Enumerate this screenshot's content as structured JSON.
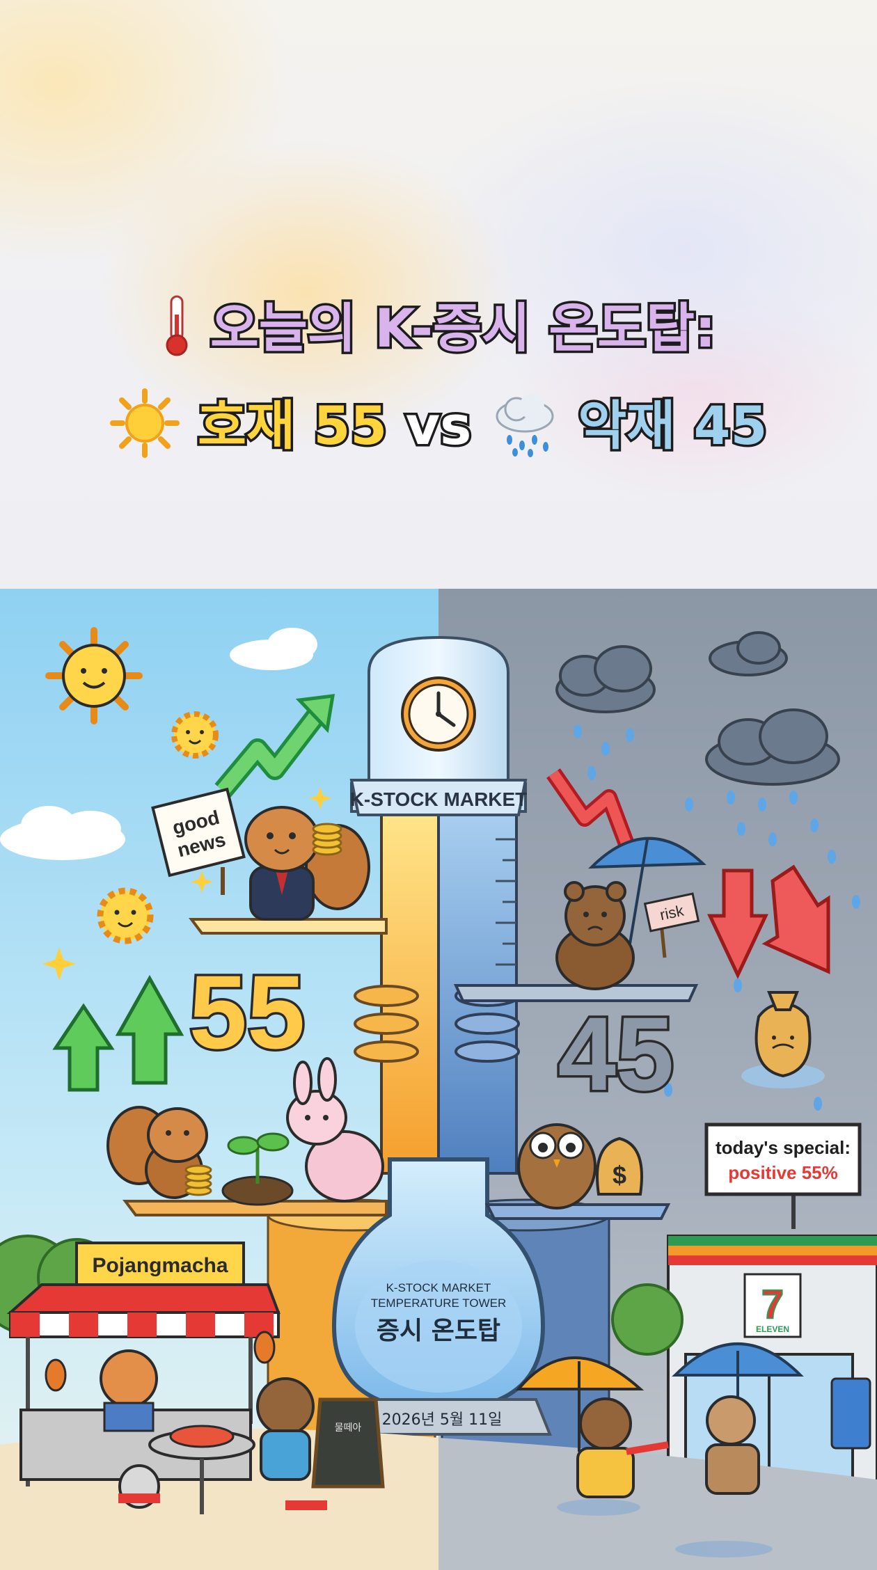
{
  "header": {
    "title_line1": "오늘의 K-증시 온도탑:",
    "good_label": "호재 55",
    "vs": "vs",
    "bad_label": "악재 45",
    "icons": [
      "thermometer-icon",
      "sun-icon",
      "rain-cloud-icon"
    ]
  },
  "scene": {
    "tower_banner": "K-STOCK MARKET",
    "good_value": "55",
    "bad_value": "45",
    "good_sign_line1": "good",
    "good_sign_line2": "news",
    "risk_sign": "risk",
    "bulb_label_line1": "K-STOCK MARKET",
    "bulb_label_line2": "TEMPERATURE TOWER",
    "bulb_label_korean": "증시 온도탑",
    "date_plate": "2026년 5월 11일",
    "stall_sign": "Pojangmacha",
    "chalkboard": "물떼아",
    "billboard_line1": "today's special:",
    "billboard_line2": "positive 55%",
    "store_logo": "7",
    "store_logo_sub": "ELEVEN",
    "moneybag_symbol": "$",
    "colors": {
      "good_side": "#a9dcf3",
      "bad_side": "#8e9aaa",
      "thermo_warm": "#f7b33a",
      "thermo_cool": "#6f9fd6",
      "title_purple": "#d9b3ec",
      "title_yellow": "#ffd43d",
      "title_blue": "#9fd0ee"
    }
  }
}
